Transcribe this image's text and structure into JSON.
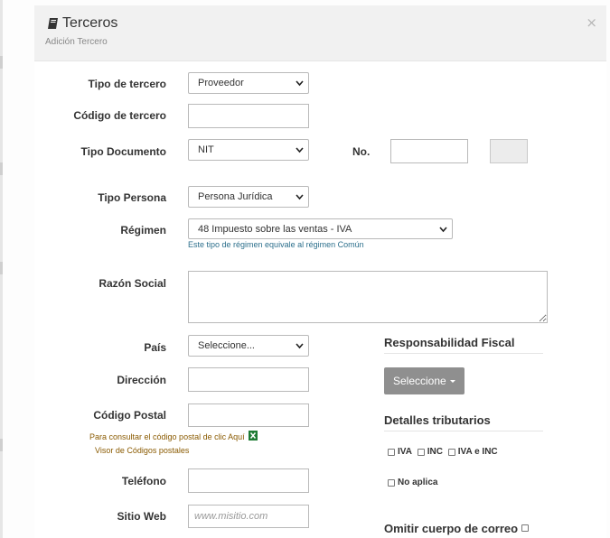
{
  "modal": {
    "title": "Terceros",
    "subtitle": "Adición Tercero",
    "close_label": "×"
  },
  "form": {
    "tipo_tercero": {
      "label": "Tipo de tercero",
      "value": "Proveedor"
    },
    "codigo_tercero": {
      "label": "Código de tercero",
      "value": ""
    },
    "tipo_documento": {
      "label": "Tipo Documento",
      "value": "NIT"
    },
    "numero": {
      "label": "No.",
      "value": ""
    },
    "tipo_persona": {
      "label": "Tipo Persona",
      "value": "Persona Jurídica"
    },
    "regimen": {
      "label": "Régimen",
      "value": "48 Impuesto sobre las ventas - IVA",
      "help": "Este tipo de régimen equivale al régimen Común"
    },
    "razon_social": {
      "label": "Razón Social",
      "value": ""
    },
    "pais": {
      "label": "País",
      "value": "Seleccione..."
    },
    "direccion": {
      "label": "Dirección",
      "value": ""
    },
    "codigo_postal": {
      "label": "Código Postal",
      "value": "",
      "help_link": "Para consultar el código postal de clic Aquí",
      "visor_link": "Visor de Códigos postales"
    },
    "telefono": {
      "label": "Teléfono",
      "value": ""
    },
    "sitio_web": {
      "label": "Sitio Web",
      "value": "",
      "placeholder": "www.misitio.com"
    }
  },
  "responsabilidad": {
    "title": "Responsabilidad Fiscal",
    "button_label": "Seleccione"
  },
  "detalles": {
    "title": "Detalles tributarios",
    "options": [
      "IVA",
      "INC",
      "IVA e INC"
    ],
    "no_aplica": "No aplica"
  },
  "omitir": {
    "label": "Omitir cuerpo de correo"
  },
  "icons": [
    "book-icon",
    "chevron-down-icon",
    "excel-icon",
    "close-icon"
  ]
}
